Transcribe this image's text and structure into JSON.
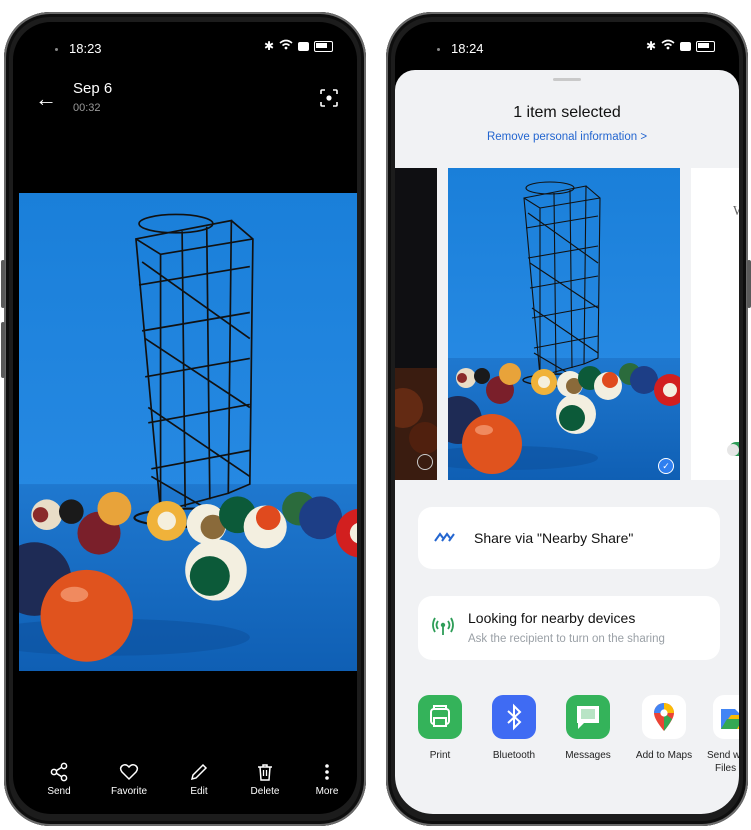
{
  "left_screen": {
    "status": {
      "time": "18:23"
    },
    "header": {
      "date": "Sep 6",
      "time": "00:32"
    },
    "toolbar": [
      {
        "key": "send",
        "label": "Send",
        "icon": "share-icon"
      },
      {
        "key": "favorite",
        "label": "Favorite",
        "icon": "heart-icon"
      },
      {
        "key": "edit",
        "label": "Edit",
        "icon": "pencil-icon"
      },
      {
        "key": "delete",
        "label": "Delete",
        "icon": "trash-icon"
      },
      {
        "key": "more",
        "label": "More",
        "icon": "more-vertical-icon"
      }
    ]
  },
  "right_screen": {
    "status": {
      "time": "18:24"
    },
    "sheet": {
      "title": "1 item selected",
      "link": "Remove personal information >",
      "next_card_letter": "W",
      "nearby_share": "Share via \"Nearby Share\"",
      "looking_title": "Looking for nearby devices",
      "looking_subtitle": "Ask the recipient to turn on the sharing"
    },
    "apps": [
      {
        "label": "Print",
        "icon": "print-icon",
        "color": "#34b35a"
      },
      {
        "label": "Bluetooth",
        "icon": "bluetooth-icon",
        "color": "#3f6bf3"
      },
      {
        "label": "Messages",
        "icon": "messages-icon",
        "color": "#34b35a"
      },
      {
        "label": "Add to Maps",
        "icon": "maps-pin-icon",
        "color": "#ffffff"
      },
      {
        "label": "Send w",
        "label2": "Files a",
        "icon": "files-icon",
        "color": "#ffffff"
      }
    ]
  },
  "colors": {
    "accent": "#2466d0",
    "photo_bg": "#1e82d8",
    "table": "#1b6ec6",
    "check": "#2f7ff0"
  }
}
